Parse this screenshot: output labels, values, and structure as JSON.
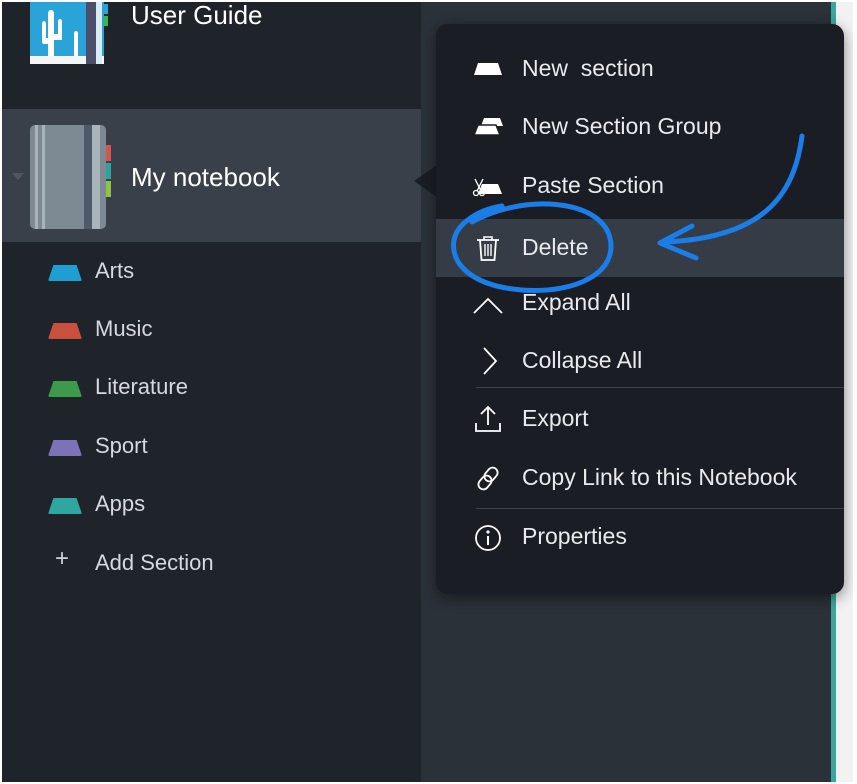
{
  "sidebar": {
    "notebooks": [
      {
        "title": "User Guide",
        "icon": "notebook-cactus-icon"
      },
      {
        "title": "My notebook",
        "icon": "notebook-gray-icon",
        "selected": true
      }
    ],
    "sections": [
      {
        "label": "Arts",
        "color": "#1e9fd4"
      },
      {
        "label": "Music",
        "color": "#c9503f"
      },
      {
        "label": "Literature",
        "color": "#3d9a4a"
      },
      {
        "label": "Sport",
        "color": "#7b72b8"
      },
      {
        "label": "Apps",
        "color": "#2fa7a0"
      }
    ],
    "add_section": {
      "icon": "+",
      "label": "Add Section"
    }
  },
  "context_menu": {
    "items": [
      {
        "label": "New  section",
        "icon": "new-section-icon"
      },
      {
        "label": "New Section Group",
        "icon": "new-section-group-icon"
      },
      {
        "label": "Paste Section",
        "icon": "paste-section-icon"
      },
      {
        "label": "Delete",
        "icon": "trash-icon",
        "highlighted": true
      },
      {
        "label": "Expand All",
        "icon": "chevron-up-icon"
      },
      {
        "label": "Collapse All",
        "icon": "chevron-right-icon"
      },
      {
        "label": "Export",
        "icon": "export-icon"
      },
      {
        "label": "Copy Link to this Notebook",
        "icon": "link-icon"
      },
      {
        "label": "Properties",
        "icon": "info-icon"
      }
    ]
  },
  "annotation": {
    "color": "#1a7de8",
    "target": "Delete"
  },
  "colors": {
    "sidebar_bg": "#1f232a",
    "selected_row_bg": "#39404a",
    "menu_bg": "#1a1e24",
    "menu_highlight_bg": "#353c45",
    "teal_accent": "#3aa79c"
  }
}
